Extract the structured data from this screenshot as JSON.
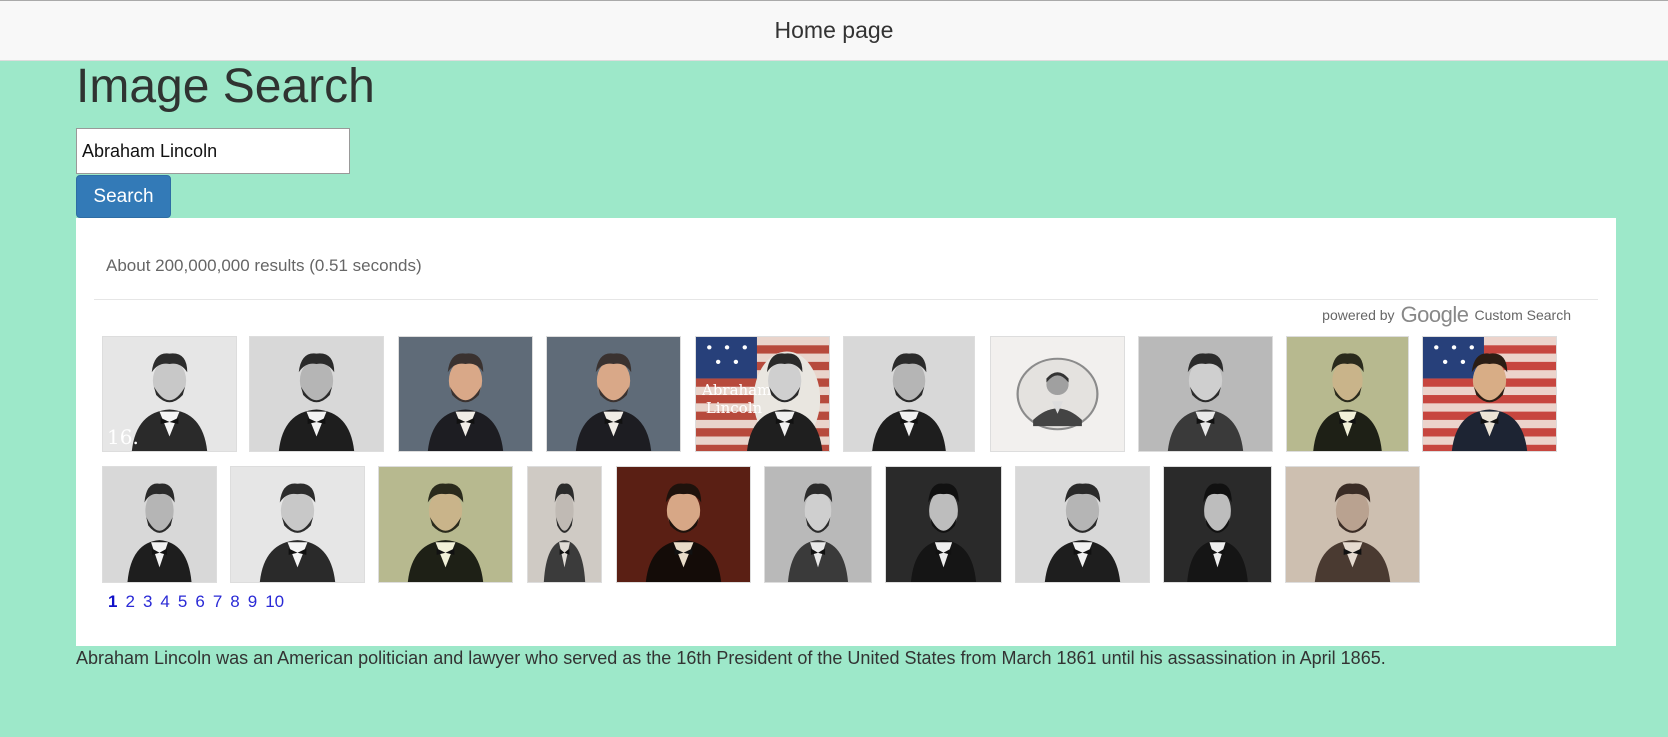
{
  "navbar": {
    "home_label": "Home page"
  },
  "page": {
    "title": "Image Search"
  },
  "search": {
    "value": "Abraham Lincoln",
    "button_label": "Search"
  },
  "results": {
    "summary": "About 200,000,000 results (0.51 seconds)",
    "branding": {
      "prefix": "powered by",
      "logo": "Google",
      "suffix": "Custom Search"
    },
    "thumbnails": [
      {
        "tone": "bw-light",
        "caption": "16."
      },
      {
        "tone": "bw",
        "caption": ""
      },
      {
        "tone": "color-gray",
        "caption": ""
      },
      {
        "tone": "color-gray",
        "caption": ""
      },
      {
        "tone": "flag-text",
        "caption": "Abraham Lincoln"
      },
      {
        "tone": "bw",
        "caption": ""
      },
      {
        "tone": "medallion",
        "caption": ""
      },
      {
        "tone": "bw-standing",
        "caption": ""
      },
      {
        "tone": "olive",
        "caption": ""
      },
      {
        "tone": "flag-painting",
        "caption": ""
      },
      {
        "tone": "bw",
        "caption": ""
      },
      {
        "tone": "bw-light",
        "caption": ""
      },
      {
        "tone": "olive",
        "caption": ""
      },
      {
        "tone": "bw-full",
        "caption": ""
      },
      {
        "tone": "painting-red",
        "caption": ""
      },
      {
        "tone": "bw-standing",
        "caption": ""
      },
      {
        "tone": "bw-dark",
        "caption": ""
      },
      {
        "tone": "bw",
        "caption": ""
      },
      {
        "tone": "bw-dark",
        "caption": ""
      },
      {
        "tone": "sepia",
        "caption": ""
      }
    ],
    "pages": [
      "1",
      "2",
      "3",
      "4",
      "5",
      "6",
      "7",
      "8",
      "9",
      "10"
    ],
    "current_page": "1"
  },
  "description": "Abraham Lincoln was an American politician and lawyer who served as the 16th President of the United States from March 1861 until his assassination in April 1865.",
  "colors": {
    "page_background": "#9de8c9",
    "button": "#337ab7",
    "link": "#2a2ad6"
  }
}
